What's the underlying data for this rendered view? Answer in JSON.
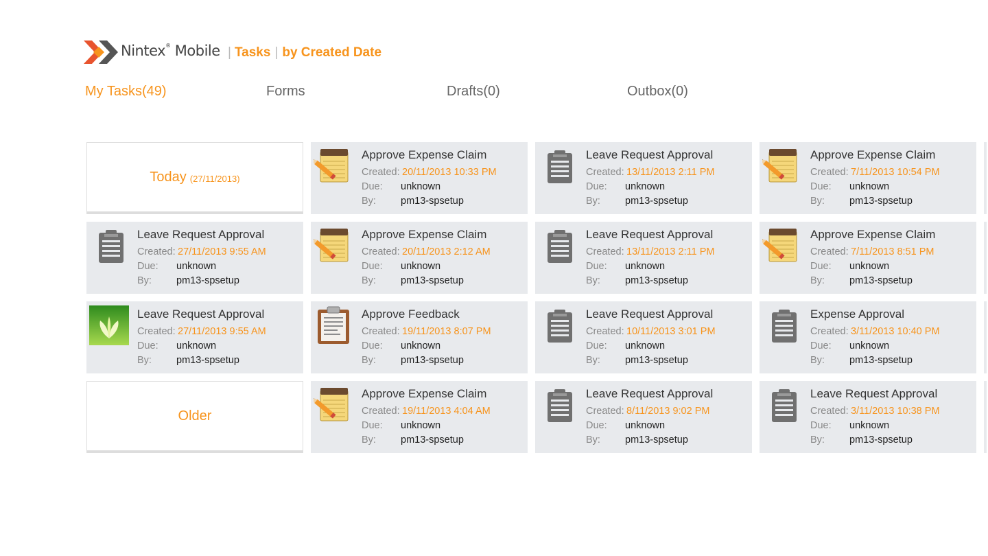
{
  "brand": {
    "name": "Nintex",
    "tm": "®",
    "product": "Mobile"
  },
  "breadcrumb": {
    "section": "Tasks",
    "view": "by Created Date"
  },
  "nav": [
    {
      "label": "My Tasks(49)",
      "active": true
    },
    {
      "label": "Forms",
      "active": false
    },
    {
      "label": "Drafts(0)",
      "active": false
    },
    {
      "label": "Outbox(0)",
      "active": false
    }
  ],
  "labels": {
    "created": "Created:",
    "due": "Due:",
    "by": "By:"
  },
  "groups": {
    "today": {
      "label": "Today",
      "date": "(27/11/2013)"
    },
    "older": {
      "label": "Older"
    }
  },
  "tasks": [
    {
      "icon": "notepad-pencil-icon",
      "title": "Approve Expense Claim",
      "created": "20/11/2013 10:33 PM",
      "due": "unknown",
      "by": "pm13-spsetup"
    },
    {
      "icon": "clipboard-gray-icon",
      "title": "Leave Request Approval",
      "created": "13/11/2013 2:11 PM",
      "due": "unknown",
      "by": "pm13-spsetup"
    },
    {
      "icon": "notepad-pencil-icon",
      "title": "Approve Expense Claim",
      "created": "7/11/2013 10:54 PM",
      "due": "unknown",
      "by": "pm13-spsetup"
    },
    {
      "icon": "clipboard-gray-icon",
      "title": "Leave Request Approval",
      "created": "27/11/2013 9:55 AM",
      "due": "unknown",
      "by": "pm13-spsetup"
    },
    {
      "icon": "notepad-pencil-icon",
      "title": "Approve Expense Claim",
      "created": "20/11/2013 2:12 AM",
      "due": "unknown",
      "by": "pm13-spsetup"
    },
    {
      "icon": "clipboard-gray-icon",
      "title": "Leave Request Approval",
      "created": "13/11/2013 2:11 PM",
      "due": "unknown",
      "by": "pm13-spsetup"
    },
    {
      "icon": "notepad-pencil-icon",
      "title": "Approve Expense Claim",
      "created": "7/11/2013 8:51 PM",
      "due": "unknown",
      "by": "pm13-spsetup"
    },
    {
      "icon": "green-leaf-icon",
      "title": "Leave Request Approval",
      "created": "27/11/2013 9:55 AM",
      "due": "unknown",
      "by": "pm13-spsetup"
    },
    {
      "icon": "clipboard-brown-icon",
      "title": "Approve Feedback",
      "created": "19/11/2013 8:07 PM",
      "due": "unknown",
      "by": "pm13-spsetup"
    },
    {
      "icon": "clipboard-gray-icon",
      "title": "Leave Request Approval",
      "created": "10/11/2013 3:01 PM",
      "due": "unknown",
      "by": "pm13-spsetup"
    },
    {
      "icon": "clipboard-gray-icon",
      "title": "Expense Approval",
      "created": "3/11/2013 10:40 PM",
      "due": "unknown",
      "by": "pm13-spsetup"
    },
    {
      "icon": "notepad-pencil-icon",
      "title": "Approve Expense Claim",
      "created": "19/11/2013 4:04 AM",
      "due": "unknown",
      "by": "pm13-spsetup"
    },
    {
      "icon": "clipboard-gray-icon",
      "title": "Leave Request Approval",
      "created": "8/11/2013 9:02 PM",
      "due": "unknown",
      "by": "pm13-spsetup"
    },
    {
      "icon": "clipboard-gray-icon",
      "title": "Leave Request Approval",
      "created": "3/11/2013 10:38 PM",
      "due": "unknown",
      "by": "pm13-spsetup"
    }
  ],
  "colors": {
    "accent": "#F7941D",
    "tile": "#E8EAED",
    "text": "#333333",
    "muted": "#888888"
  }
}
